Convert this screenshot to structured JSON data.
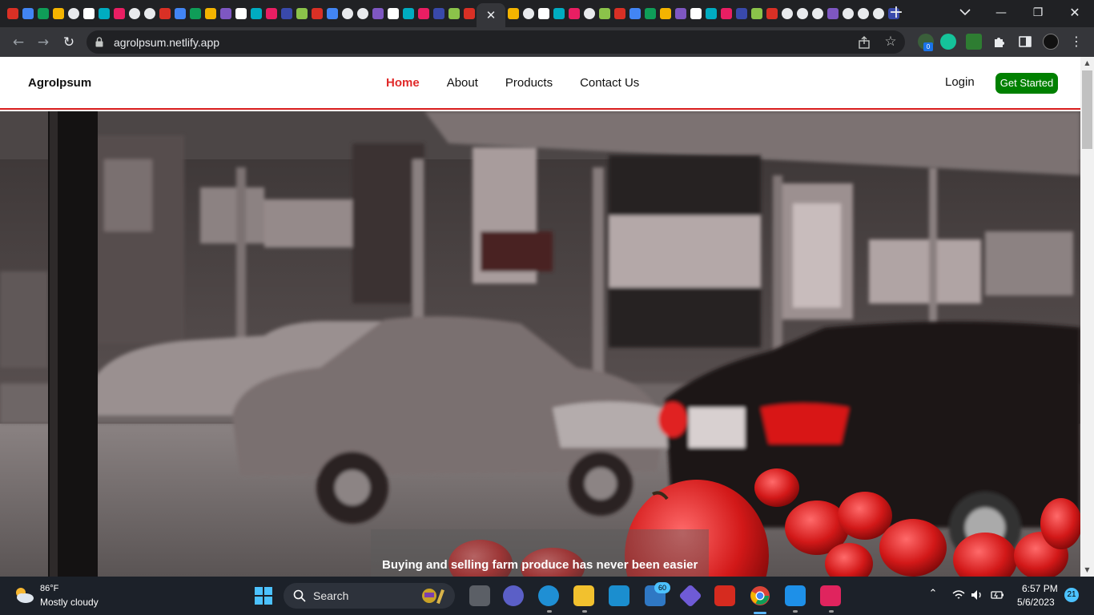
{
  "browser": {
    "new_tab_label": "+",
    "close_tab_glyph": "✕",
    "window_controls": {
      "minimize": "—",
      "maximize": "❐",
      "close": "✕"
    },
    "url": "agrolpsum.netlify.app",
    "extension_badge": "0",
    "favicons": [
      "gmail-icon",
      "w-icon",
      "figma-icon",
      "discord-icon",
      "github-icon",
      "youtube-icon",
      "star-icon",
      "c-icon",
      "circle-icon",
      "circle-icon",
      "gem-icon",
      "doc-icon",
      "sheet-icon",
      "green-icon",
      "blue-icon",
      "google-icon",
      "doc-icon",
      "yellow-icon",
      "c-icon",
      "black-icon",
      "shapes-icon",
      "red-icon",
      "github-icon",
      "github-icon",
      "flag-icon",
      "red-icon",
      "moon-icon",
      "c-icon",
      "live-icon",
      "live-icon",
      "gem-icon"
    ],
    "favicons_right": [
      "doc-icon",
      "github-icon",
      "twitter-icon",
      "grid-icon",
      "twitter-icon",
      "github-icon",
      "a-icon",
      "coin-icon",
      "linkedin-icon",
      "seven-icon",
      "px-icon",
      "d-icon",
      "ai-icon",
      "fx-icon",
      "orange-icon",
      "up-icon",
      "purple-icon",
      "blue-icon",
      "github-icon",
      "github-icon",
      "github-icon",
      "red-icon",
      "github-icon",
      "dark-icon",
      "github-icon",
      "doc-icon"
    ]
  },
  "site": {
    "brand": "AgroIpsum",
    "nav": [
      "Home",
      "About",
      "Products",
      "Contact Us"
    ],
    "login": "Login",
    "cta": "Get Started",
    "hero_text": "Buying and selling farm produce has never been easier",
    "accent_color": "#d91d1d",
    "cta_color": "#008000"
  },
  "taskbar": {
    "temperature": "86°F",
    "weather": "Mostly cloudy",
    "search_label": "Search",
    "mail_badge": "60",
    "time": "6:57 PM",
    "date": "5/6/2023",
    "notifications": "21",
    "apps": [
      "file-explorer-icon",
      "teams-icon",
      "edge-icon",
      "folder-icon",
      "store-icon",
      "mail-icon",
      "copilot-icon",
      "wps-icon",
      "chrome-icon",
      "vscode-icon",
      "media-player-icon"
    ]
  }
}
